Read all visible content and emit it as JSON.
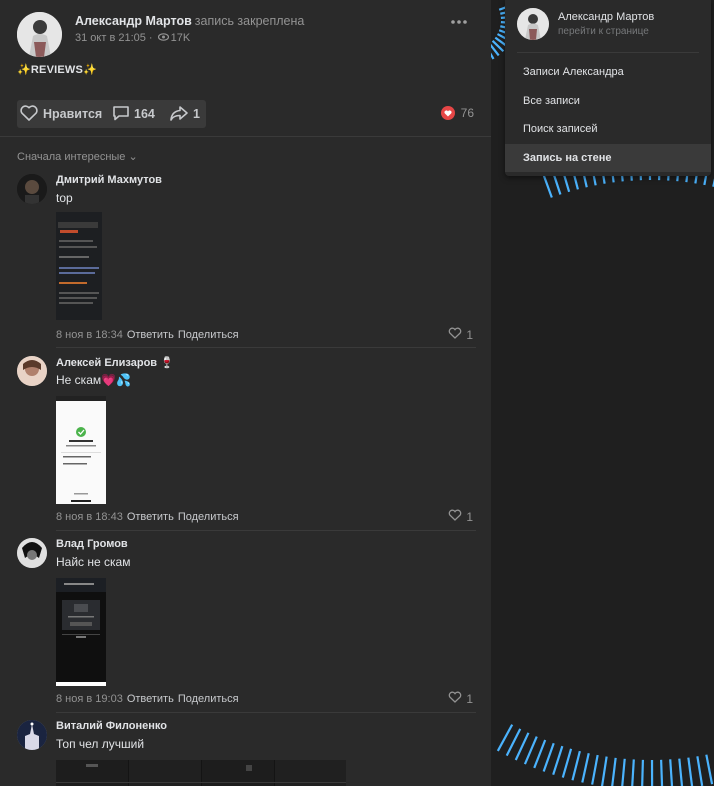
{
  "post": {
    "author": "Александр Мартов",
    "pinned_text": "запись закреплена",
    "date": "31 окт в 21:05",
    "views": "17K",
    "text": "✨REVIEWS✨",
    "actions": {
      "like_label": "Нравится",
      "comments_count": "164",
      "shares_count": "1"
    },
    "reactions_count": "76",
    "sort_label": "Сначала интересные"
  },
  "comments": [
    {
      "name": "Дмитрий Махмутов",
      "text": "top",
      "date": "8 ноя в 18:34",
      "reply": "Ответить",
      "share": "Поделиться",
      "likes": "1"
    },
    {
      "name": "Алексей Елизаров 🍷",
      "text": "Не скам💗💦",
      "date": "8 ноя в 18:43",
      "reply": "Ответить",
      "share": "Поделиться",
      "likes": "1"
    },
    {
      "name": "Влад Громов",
      "text": "Найс не скам",
      "date": "8 ноя в 19:03",
      "reply": "Ответить",
      "share": "Поделиться",
      "likes": "1"
    },
    {
      "name": "Виталий Филоненко",
      "text": "Топ чел лучший"
    }
  ],
  "menu": {
    "name": "Александр Мартов",
    "subtitle": "перейти к странице",
    "items": [
      "Записи Александра",
      "Все записи",
      "Поиск записей",
      "Запись на стене"
    ]
  },
  "colors": {
    "accent": "#4bb3fd",
    "heart": "#e64646",
    "background": "#222222"
  }
}
